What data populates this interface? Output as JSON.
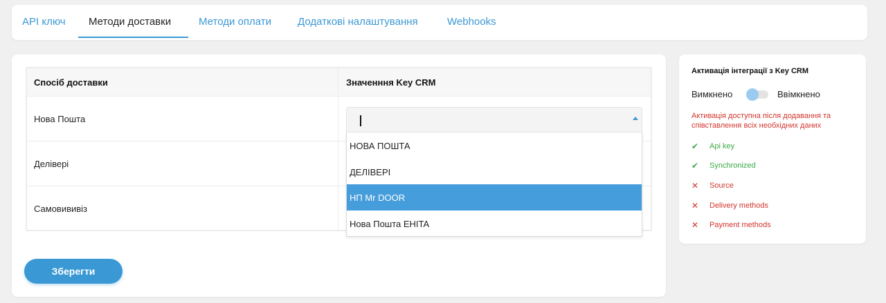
{
  "tabs": [
    {
      "label": "API ключ",
      "active": false
    },
    {
      "label": "Методи доставки",
      "active": true
    },
    {
      "label": "Методи оплати",
      "active": false
    },
    {
      "label": "Додаткові налаштування",
      "active": false
    },
    {
      "label": "Webhooks",
      "active": false
    }
  ],
  "table": {
    "headers": [
      "Спосіб доставки",
      "Значенння Key CRM"
    ],
    "rows": [
      {
        "label": "Нова Пошта"
      },
      {
        "label": "Делівері"
      },
      {
        "label": "Самовививіз"
      }
    ]
  },
  "select": {
    "value": "",
    "options": [
      "НОВА ПОШТА",
      "ДЕЛІВЕРІ",
      "НП Mr DOOR",
      "Нова Пошта EHITA"
    ],
    "highlighted": "НП Mr DOOR"
  },
  "save_button": {
    "label": "Зберегти"
  },
  "integration": {
    "title": "Активація інтеграції з Key CRM",
    "toggle_off_label": "Вимкнено",
    "toggle_on_label": "Ввімкнено",
    "toggle_state": "off",
    "warning": "Активація доступна після додавання та співставлення всіх необхідних даних",
    "checklist": [
      {
        "label": "Api key",
        "status": "ok",
        "icon": "check-icon"
      },
      {
        "label": "Synchronized",
        "status": "ok",
        "icon": "check-icon"
      },
      {
        "label": "Source",
        "status": "missing",
        "icon": "cross-icon"
      },
      {
        "label": "Delivery methods",
        "status": "missing",
        "icon": "cross-icon"
      },
      {
        "label": "Payment methods",
        "status": "missing",
        "icon": "cross-icon"
      }
    ]
  },
  "colors": {
    "accent": "#3a98d4",
    "selected_option": "#469ddb",
    "ok": "#3ba845",
    "error": "#d0342c"
  }
}
